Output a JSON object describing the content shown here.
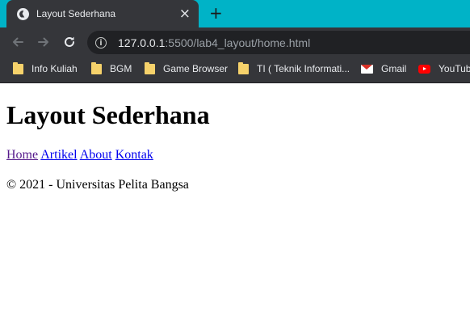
{
  "browser": {
    "tab": {
      "title": "Layout Sederhana",
      "favicon": "globe-icon",
      "close": "×"
    },
    "new_tab": "+",
    "url": {
      "host": "127.0.0.1",
      "path": ":5500/lab4_layout/home.html"
    },
    "bookmarks": [
      {
        "label": "Info Kuliah",
        "icon": "folder-icon"
      },
      {
        "label": "BGM",
        "icon": "folder-icon"
      },
      {
        "label": "Game Browser",
        "icon": "folder-icon"
      },
      {
        "label": "TI ( Teknik Informati...",
        "icon": "folder-icon"
      },
      {
        "label": "Gmail",
        "icon": "gmail-icon"
      },
      {
        "label": "YouTube",
        "icon": "youtube-icon"
      }
    ]
  },
  "page": {
    "heading": "Layout Sederhana",
    "nav": [
      {
        "label": "Home"
      },
      {
        "label": "Artikel"
      },
      {
        "label": "About"
      },
      {
        "label": "Kontak"
      }
    ],
    "footer": "© 2021 - Universitas Pelita Bangsa"
  },
  "colors": {
    "tab_strip": "#00b3c7",
    "chrome_dark": "#35363a",
    "omnibox": "#202124",
    "link": "#0000ee",
    "visited_link": "#551a8b"
  }
}
